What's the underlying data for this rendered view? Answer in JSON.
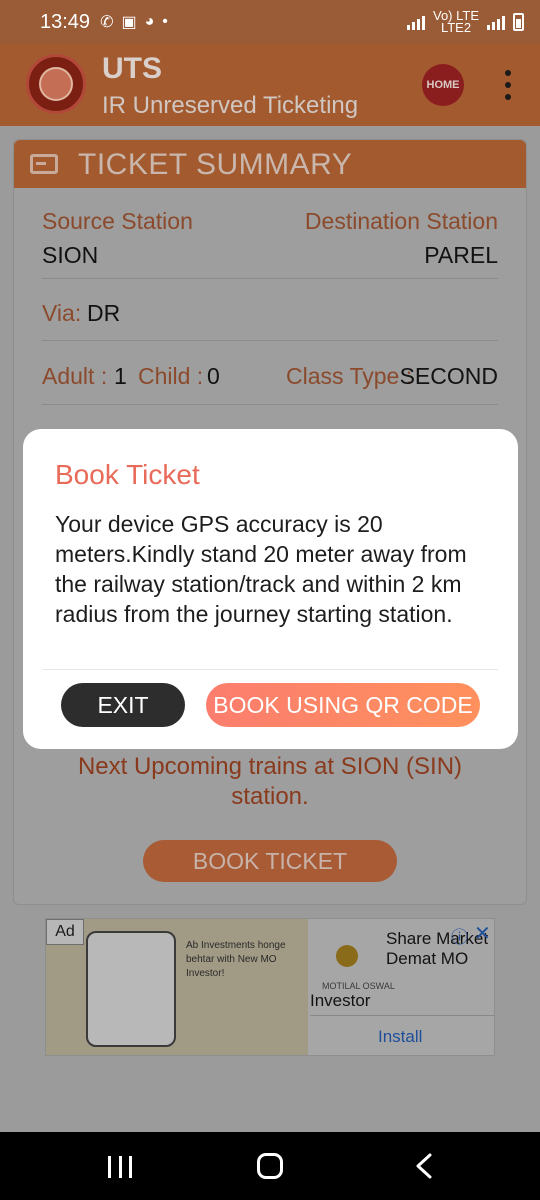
{
  "status_bar": {
    "time": "13:49",
    "network_label": "Vo) LTE",
    "network_label2": "LTE2"
  },
  "app_header": {
    "title": "UTS",
    "subtitle": "IR Unreserved Ticketing",
    "home_label": "HOME",
    "colors": {
      "header": "#a35a2e",
      "accent": "#e86b59"
    }
  },
  "ticket_summary": {
    "title": "TICKET SUMMARY",
    "source_label": "Source Station",
    "source_value": "SION",
    "destination_label": "Destination Station",
    "destination_value": "PAREL",
    "via_label": "Via:",
    "via_value": "DR",
    "adult_label": "Adult :",
    "adult_value": "1",
    "child_label": "Child :",
    "child_value": "0",
    "class_label": "Class Type :",
    "class_value": "SECOND"
  },
  "upcoming_trains_link": "Next Upcoming trains at SION (SIN) station.",
  "book_ticket_button": "BOOK TICKET",
  "ad": {
    "badge": "Ad",
    "headline": "Ab Investments honge behtar with New MO Investor!",
    "brand": "MOTILAL OSWAL",
    "text": "Share Market Demat MO",
    "investor": "Investor",
    "install": "Install"
  },
  "dialog": {
    "title": "Book Ticket",
    "message": "Your device GPS accuracy is 20 meters.Kindly stand 20 meter away from the railway station/track and within 2 km radius from the journey starting station.",
    "exit_label": "EXIT",
    "qr_label": "BOOK USING QR CODE"
  }
}
